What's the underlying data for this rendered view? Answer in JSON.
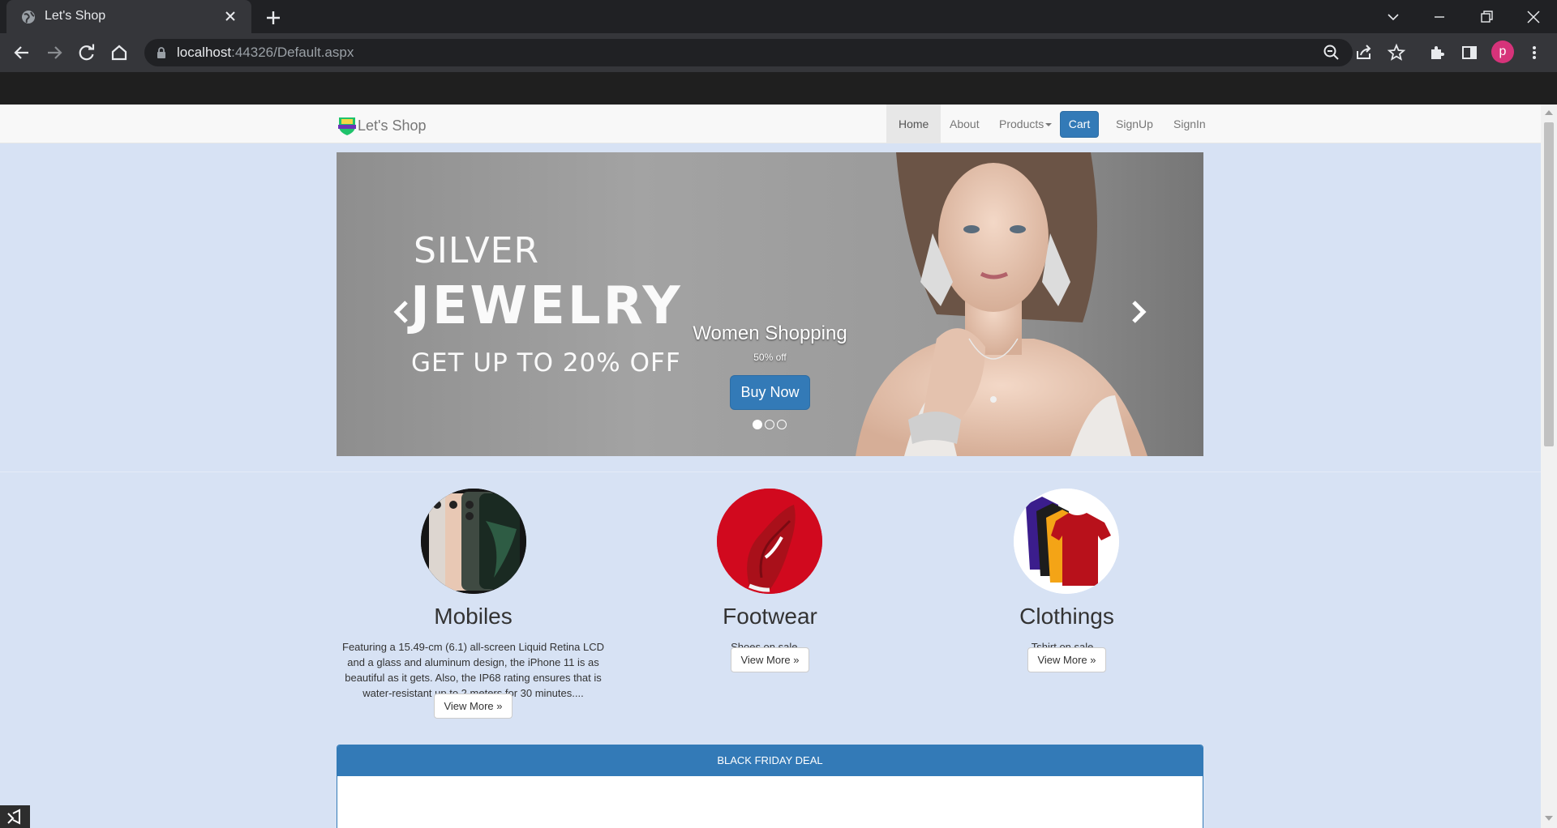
{
  "browser": {
    "tab_title": "Let's Shop",
    "url_host": "localhost",
    "url_rest": ":44326/Default.aspx",
    "profile_initial": "p"
  },
  "site": {
    "brand": "Let's Shop",
    "nav": {
      "home": "Home",
      "about": "About",
      "products": "Products",
      "cart": "Cart",
      "signup": "SignUp",
      "signin": "SignIn"
    }
  },
  "carousel": {
    "ad_line1": "SILVER",
    "ad_line2": "JEWELRY",
    "ad_line3": "GET UP TO 20% OFF",
    "caption_title": "Women Shopping",
    "caption_sub": "50% off",
    "button": "Buy Now",
    "active_slide": 1,
    "slide_count": 3
  },
  "categories": [
    {
      "name": "Mobiles",
      "description": "Featuring a 15.49-cm (6.1) all-screen Liquid Retina LCD and a glass and aluminum design, the iPhone 11 is as beautiful as it gets. Also, the IP68 rating ensures that is water-resistant up to 2 meters for 30 minutes....",
      "button": "View More »"
    },
    {
      "name": "Footwear",
      "description": "Shoes on sale....",
      "button": "View More »"
    },
    {
      "name": "Clothings",
      "description": "Tshirt on sale...",
      "button": "View More »"
    }
  ],
  "deal_panel": {
    "heading": "BLACK FRIDAY DEAL"
  },
  "colors": {
    "primary": "#337ab7",
    "page_bg": "#d7e2f4"
  }
}
